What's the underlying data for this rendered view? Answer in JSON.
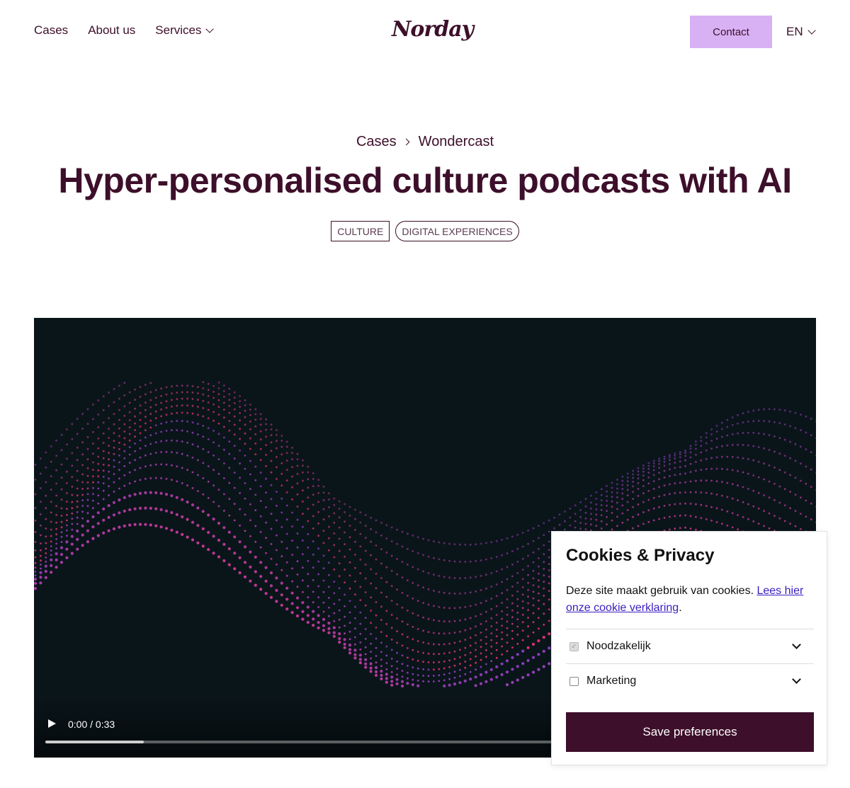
{
  "nav": {
    "items": [
      {
        "label": "Cases"
      },
      {
        "label": "About us"
      },
      {
        "label": "Services"
      }
    ],
    "logo": "Norday",
    "contact_label": "Contact",
    "language": "EN"
  },
  "hero": {
    "breadcrumb": [
      "Cases",
      "Wondercast"
    ],
    "title": "Hyper-personalised culture podcasts with AI",
    "tags": [
      "CULTURE",
      "DIGITAL EXPERIENCES"
    ]
  },
  "video": {
    "time": "0:00 / 0:33",
    "progress_fraction": 0.13,
    "colors": {
      "background": "#0a151a",
      "accent_pink": "#e8336f",
      "accent_purple": "#8a3fc4"
    }
  },
  "cookie": {
    "title": "Cookies & Privacy",
    "text": "Deze site maakt gebruik van cookies.",
    "link": "Lees hier onze cookie verklaring",
    "period": ".",
    "options": [
      {
        "label": "Noodzakelijk",
        "checked": true
      },
      {
        "label": "Marketing",
        "checked": false
      }
    ],
    "save_label": "Save preferences"
  },
  "colors": {
    "brand": "#3d0f2a",
    "contact_bg": "#d8b1f4"
  }
}
